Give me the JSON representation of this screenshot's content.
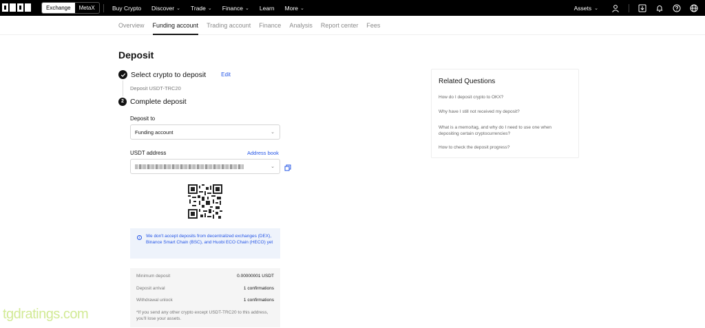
{
  "topbar": {
    "switch": [
      "Exchange",
      "MetaX"
    ],
    "nav": [
      {
        "label": "Buy Crypto",
        "dropdown": false
      },
      {
        "label": "Discover",
        "dropdown": true
      },
      {
        "label": "Trade",
        "dropdown": true
      },
      {
        "label": "Finance",
        "dropdown": true
      },
      {
        "label": "Learn",
        "dropdown": false
      },
      {
        "label": "More",
        "dropdown": true
      }
    ],
    "assets_label": "Assets",
    "right_icons": [
      "user-icon",
      "download-icon",
      "bell-icon",
      "help-icon",
      "globe-icon"
    ]
  },
  "subnav": {
    "tabs": [
      "Overview",
      "Funding account",
      "Trading account",
      "Finance",
      "Analysis",
      "Report center",
      "Fees"
    ],
    "active": "Funding account"
  },
  "page": {
    "title": "Deposit",
    "step1": {
      "title": "Select crypto to deposit",
      "edit": "Edit",
      "sub": "Deposit USDT-TRC20"
    },
    "step2": {
      "num": "2",
      "title": "Complete deposit"
    },
    "deposit_to": {
      "label": "Deposit to",
      "value": "Funding account"
    },
    "address": {
      "label": "USDT address",
      "address_book": "Address book"
    },
    "notice": "We don't accept deposits from decentralized exchanges (DEX), Binance Smart Chain (BSC), and Huobi ECO Chain (HECO) yet",
    "info": {
      "rows": [
        {
          "k": "Minimum deposit",
          "v": "0.00000001 USDT"
        },
        {
          "k": "Deposit arrival",
          "v": "1 confirmations"
        },
        {
          "k": "Withdrawal unlock",
          "v": "1 confirmations"
        }
      ],
      "note": "*If you send any other crypto except USDT-TRC20 to this address, you'll lose your assets."
    }
  },
  "related": {
    "title": "Related Questions",
    "questions": [
      "How do I deposit crypto to OKX?",
      "Why have I still not received my deposit?",
      "What is a memo/tag, and why do I need to use one when depositing certain cryptocurrencies?",
      "How to check the deposit progress?"
    ]
  },
  "watermark": "tgdratings.com",
  "colors": {
    "accent": "#2354e6",
    "notice_bg": "#eef3fb",
    "topbar_bg": "#000000"
  }
}
